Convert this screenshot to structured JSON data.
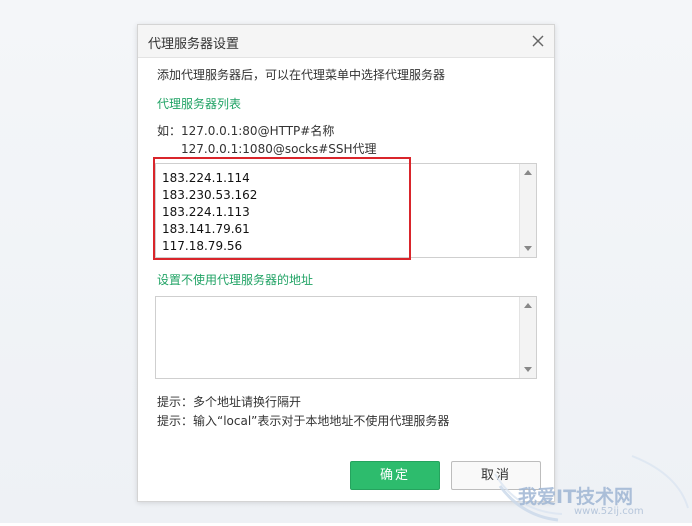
{
  "dialog": {
    "title": "代理服务器设置",
    "description": "添加代理服务器后，可以在代理菜单中选择代理服务器",
    "proxy_list_label": "代理服务器列表",
    "example_line1": "如：127.0.0.1:80@HTTP#名称",
    "example_line2": "127.0.0.1:1080@socks#SSH代理",
    "proxy_entries": [
      "183.224.1.114",
      "183.230.53.162",
      "183.224.1.113",
      "183.141.79.61",
      "117.18.79.56"
    ],
    "bypass_label": "设置不使用代理服务器的地址",
    "bypass_value": "",
    "hint1": "提示：多个地址请换行隔开",
    "hint2": "提示：输入“local”表示对于本地地址不使用代理服务器",
    "ok_label": "确定",
    "cancel_label": "取消"
  },
  "watermark": {
    "text": "我爱IT技术网",
    "url": "www.52ij.com"
  },
  "colors": {
    "accent_green": "#21a365",
    "ok_button": "#2dbc6d",
    "highlight_red": "#d9252b"
  }
}
